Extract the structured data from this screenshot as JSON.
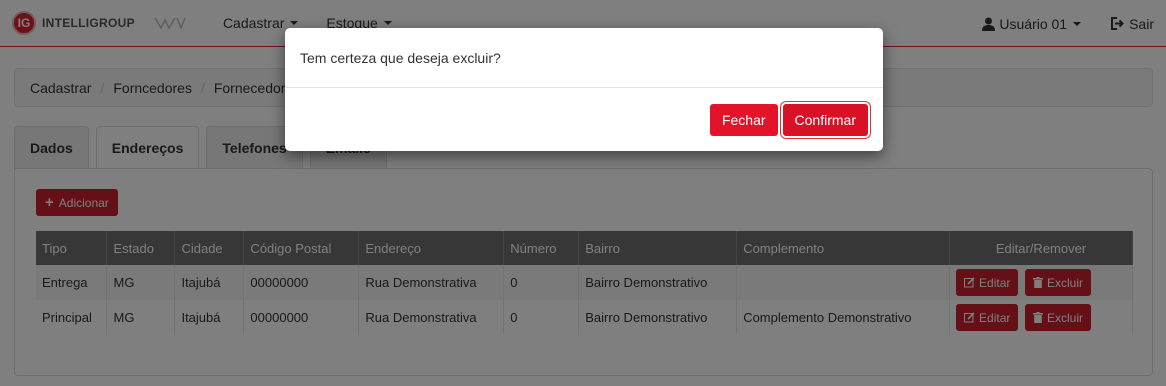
{
  "brand": {
    "logo_text": "IG",
    "name": "INTELLIGROUP"
  },
  "nav": {
    "menu": [
      {
        "label": "Cadastrar"
      },
      {
        "label": "Estoque"
      }
    ],
    "user_label": "Usuário 01",
    "exit_label": "Sair"
  },
  "breadcrumb": [
    "Cadastrar",
    "Forncedores",
    "Fornecedor"
  ],
  "tabs": [
    {
      "label": "Dados"
    },
    {
      "label": "Endereços"
    },
    {
      "label": "Telefones"
    },
    {
      "label": "Emails"
    }
  ],
  "add_button": "Adicionar",
  "table": {
    "headers": [
      "Tipo",
      "Estado",
      "Cidade",
      "Código Postal",
      "Endereço",
      "Número",
      "Bairro",
      "Complemento",
      "Editar/Remover"
    ],
    "rows": [
      [
        "Entrega",
        "MG",
        "Itajubá",
        "00000000",
        "Rua Demonstrativa",
        "0",
        "Bairro Demonstrativo",
        ""
      ],
      [
        "Principal",
        "MG",
        "Itajubá",
        "00000000",
        "Rua Demonstrativa",
        "0",
        "Bairro Demonstrativo",
        "Complemento Demonstrativo"
      ]
    ],
    "edit_label": "Editar",
    "delete_label": "Excluir"
  },
  "modal": {
    "message": "Tem certeza que deseja excluir?",
    "close_label": "Fechar",
    "confirm_label": "Confirmar"
  },
  "colors": {
    "accent": "#c9202c",
    "modal_button": "#e3142a"
  }
}
